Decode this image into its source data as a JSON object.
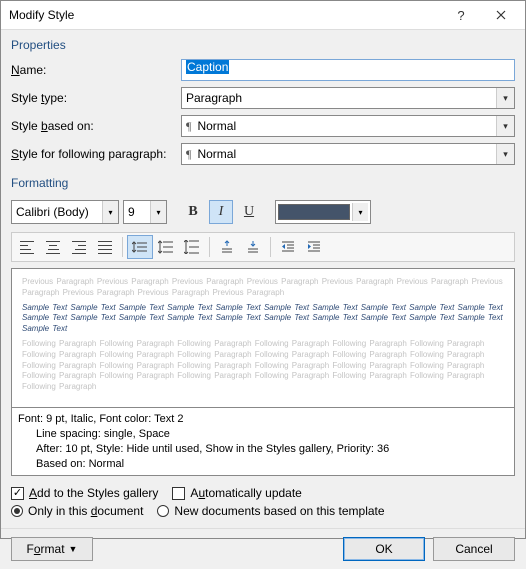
{
  "title": "Modify Style",
  "sections": {
    "properties": "Properties",
    "formatting": "Formatting"
  },
  "props": {
    "name_label": "Name:",
    "name_value": "Caption",
    "type_label": "Style type:",
    "type_value": "Paragraph",
    "based_label_pre": "Style ",
    "based_label_hot": "b",
    "based_label_post": "ased on:",
    "based_value": "Normal",
    "following_label_pre": "Style for following paragraph:",
    "following_value": "Normal"
  },
  "format": {
    "font_name": "Calibri (Body)",
    "font_size": "9",
    "bold": "B",
    "italic": "I",
    "underline": "U",
    "color": "#44546a"
  },
  "preview": {
    "ghost_prev": "Previous Paragraph Previous Paragraph Previous Paragraph Previous Paragraph Previous Paragraph Previous Paragraph Previous Paragraph Previous Paragraph Previous Paragraph Previous Paragraph",
    "sample": "Sample Text Sample Text Sample Text Sample Text Sample Text Sample Text Sample Text Sample Text Sample Text Sample Text Sample Text Sample Text Sample Text Sample Text Sample Text Sample Text Sample Text Sample Text Sample Text Sample Text Sample Text",
    "ghost_next": "Following Paragraph Following Paragraph Following Paragraph Following Paragraph Following Paragraph Following Paragraph Following Paragraph Following Paragraph Following Paragraph Following Paragraph Following Paragraph Following Paragraph Following Paragraph Following Paragraph Following Paragraph Following Paragraph Following Paragraph Following Paragraph Following Paragraph Following Paragraph Following Paragraph Following Paragraph Following Paragraph Following Paragraph Following Paragraph"
  },
  "description": {
    "l1": "Font: 9 pt, Italic, Font color: Text 2",
    "l2": "Line spacing:  single, Space",
    "l3": "After:  10 pt, Style: Hide until used, Show in the Styles gallery, Priority: 36",
    "l4": "Based on: Normal"
  },
  "options": {
    "add_gallery": "Add to the Styles gallery",
    "auto_update": "Automatically update",
    "only_doc": "Only in this document",
    "new_template": "New documents based on this template"
  },
  "buttons": {
    "format": "Format",
    "ok": "OK",
    "cancel": "Cancel"
  }
}
